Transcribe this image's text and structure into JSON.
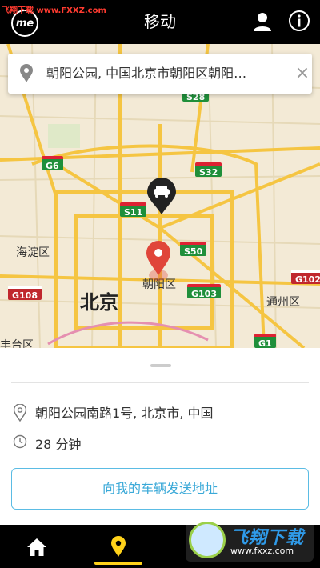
{
  "app": {
    "title": "移动",
    "logo_text": "me",
    "watermark_top": "飞翔下载 www.FXXZ.com"
  },
  "search": {
    "value": "朝阳公园, 中国北京市朝阳区朝阳…",
    "clear_label": "×"
  },
  "map": {
    "labels": [
      {
        "id": "haidian",
        "text": "海淀区"
      },
      {
        "id": "beijing",
        "text": "北京"
      },
      {
        "id": "chaoyang",
        "text": "朝阳区"
      },
      {
        "id": "tongzhou",
        "text": "通州区"
      },
      {
        "id": "fengtai",
        "text": "丰台区"
      }
    ],
    "shields": [
      {
        "id": "g6",
        "text": "G6"
      },
      {
        "id": "s11",
        "text": "S11"
      },
      {
        "id": "s32",
        "text": "S32"
      },
      {
        "id": "s50",
        "text": "S50"
      },
      {
        "id": "g103",
        "text": "G103"
      },
      {
        "id": "g102",
        "text": "G102"
      },
      {
        "id": "g108",
        "text": "G108"
      },
      {
        "id": "g1",
        "text": "G1"
      },
      {
        "id": "s28",
        "text": "S28"
      }
    ]
  },
  "details": {
    "address": "朝阳公园南路1号, 北京市, 中国",
    "duration": "28 分钟",
    "send_button": "向我的车辆发送地址"
  },
  "watermark": {
    "title": "飞翔下载",
    "url": "www.fxxz.com"
  },
  "colors": {
    "accent": "#ffd21a",
    "button_border": "#5bbce4",
    "pin_red": "#e0453a"
  }
}
